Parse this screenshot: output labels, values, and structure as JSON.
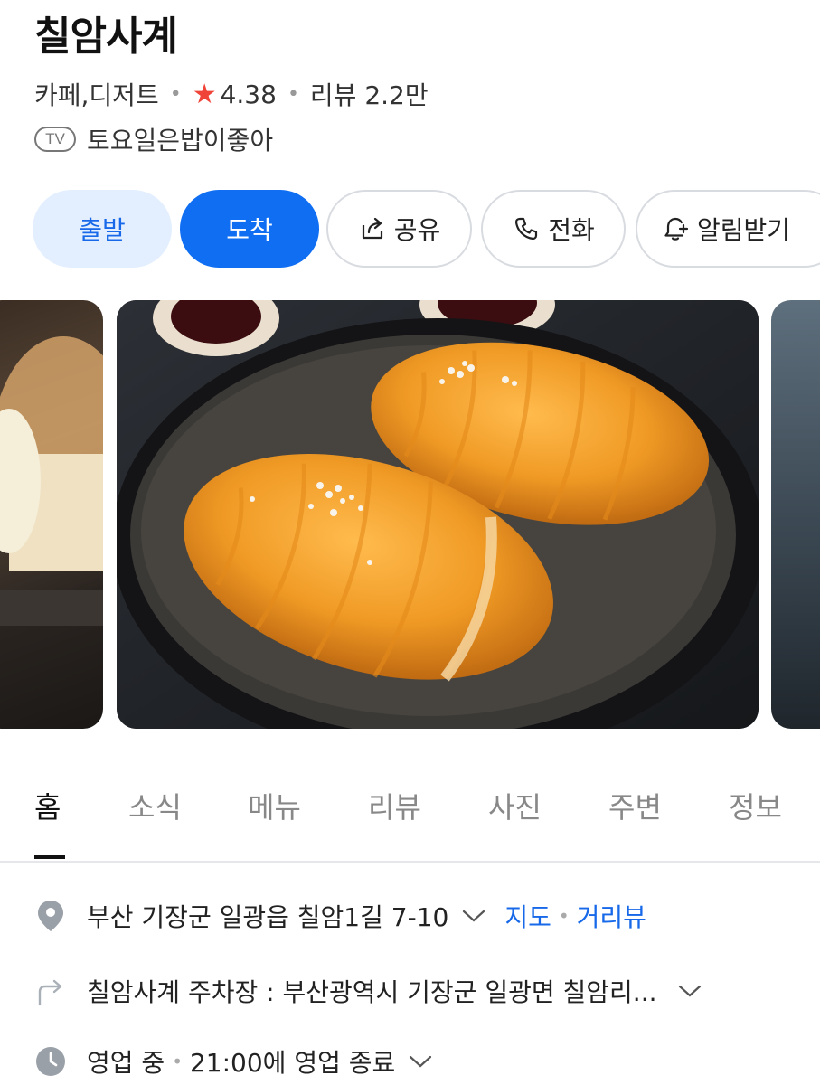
{
  "place": {
    "name": "칠암사계",
    "category": "카페,디저트",
    "rating": "4.38",
    "review_text": "리뷰 2.2만",
    "tv_badge": "TV",
    "tv_show": "토요일은밥이좋아"
  },
  "actions": {
    "depart": "출발",
    "arrive": "도착",
    "share": "공유",
    "call": "전화",
    "alarm": "알림받기"
  },
  "tabs": [
    "홈",
    "소식",
    "메뉴",
    "리뷰",
    "사진",
    "주변",
    "정보"
  ],
  "info": {
    "address": "부산 기장군 일광읍 칠암1길 7-10",
    "map_link": "지도",
    "street_view_link": "거리뷰",
    "parking": "칠암사계 주차장 : 부산광역시 기장군 일광면 칠암리...",
    "status": "영업 중",
    "hours": "21:00에 영업 종료"
  },
  "colors": {
    "accent": "#0f6ef2",
    "accent_light": "#e3efff",
    "star": "#f04438",
    "link": "#1769e9"
  },
  "icons": [
    "share-icon",
    "phone-icon",
    "bell-plus-icon",
    "location-pin-icon",
    "turn-arrow-icon",
    "clock-icon",
    "chevron-down-icon"
  ]
}
